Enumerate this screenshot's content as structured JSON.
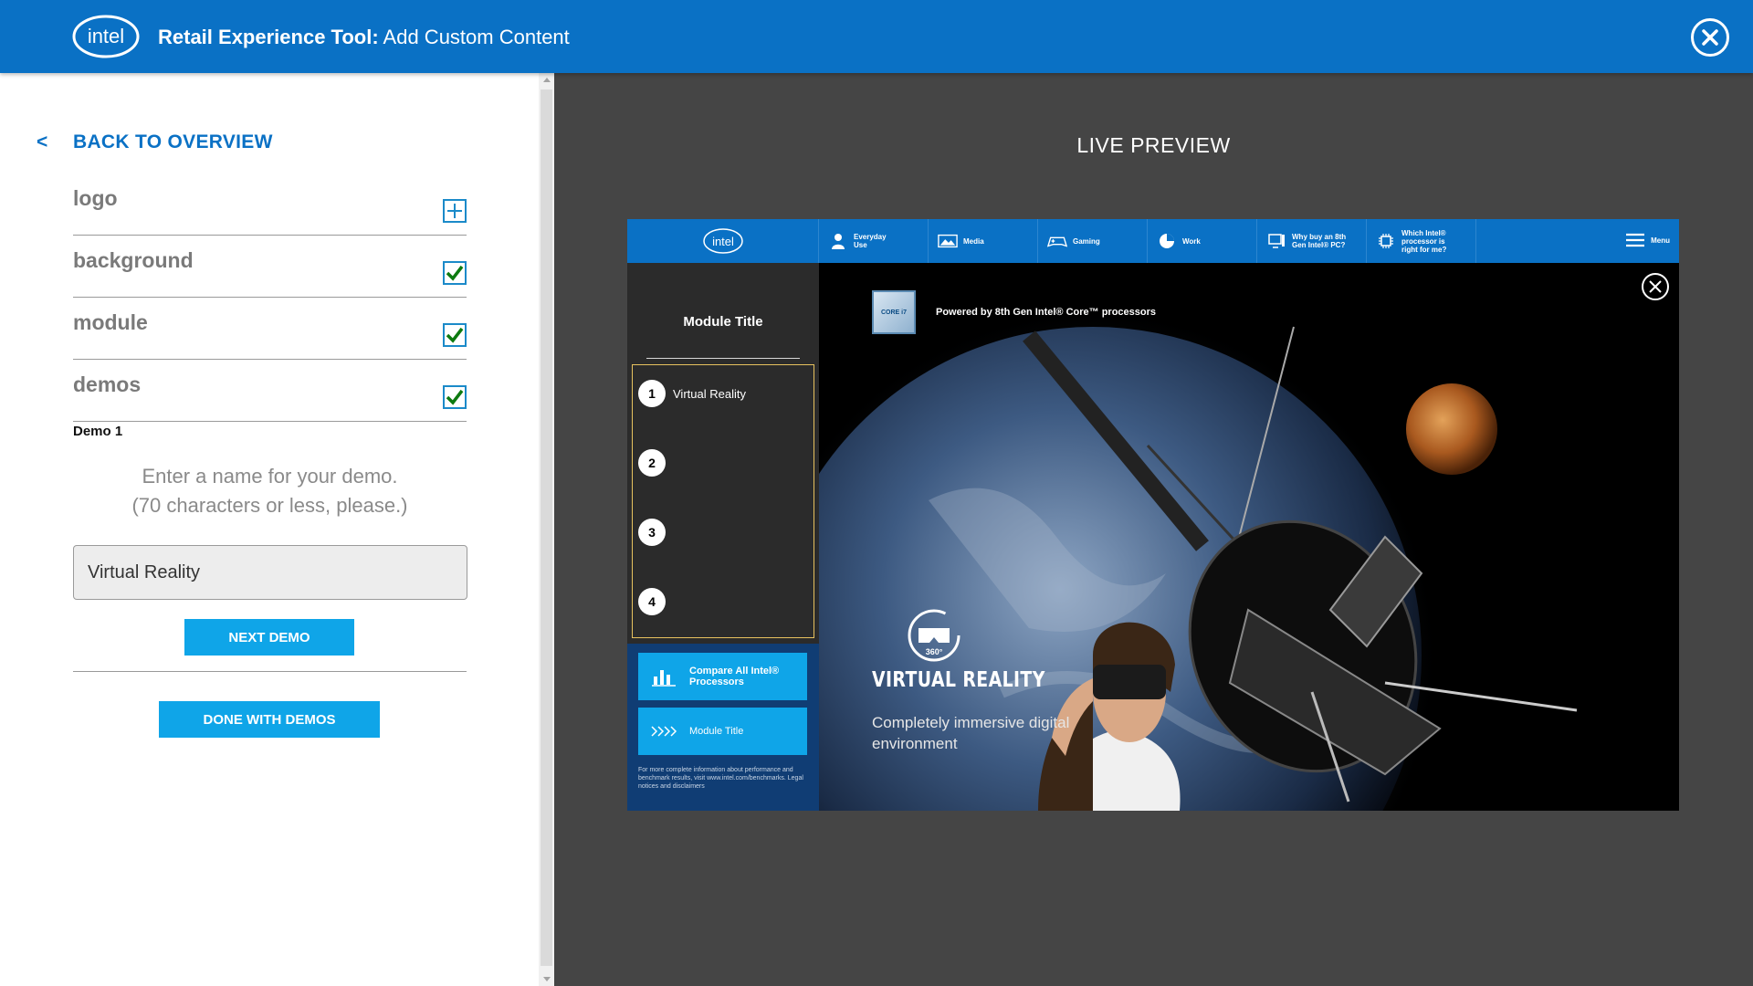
{
  "header": {
    "logo_text": "intel",
    "title_bold": "Retail Experience Tool:",
    "title_rest": " Add Custom Content"
  },
  "left": {
    "back_chevron": "<",
    "back_label": "BACK TO OVERVIEW",
    "sections": [
      {
        "label": "logo",
        "state": "add"
      },
      {
        "label": "background",
        "state": "checked"
      },
      {
        "label": "module",
        "state": "checked"
      },
      {
        "label": "demos",
        "state": "checked"
      }
    ],
    "demo_label": "Demo 1",
    "demo_hint_line1": "Enter a name for your demo.",
    "demo_hint_line2": "(70 characters or less, please.)",
    "demo_input_value": "Virtual Reality",
    "next_demo_label": "NEXT DEMO",
    "done_label": "DONE WITH DEMOS"
  },
  "preview": {
    "title": "LIVE PREVIEW",
    "nav": {
      "logo_text": "intel",
      "items": [
        {
          "label": "Everyday Use",
          "icon": "person-icon"
        },
        {
          "label": "Media",
          "icon": "image-icon"
        },
        {
          "label": "Gaming",
          "icon": "gamepad-icon"
        },
        {
          "label": "Work",
          "icon": "pie-chart-icon"
        },
        {
          "label": "Why buy an 8th Gen Intel® PC?",
          "icon": "desktop-icon"
        },
        {
          "label": "Which Intel® processor is right for me?",
          "icon": "chip-icon"
        }
      ],
      "menu_label": "Menu"
    },
    "side": {
      "module_title": "Module Title",
      "demos": [
        {
          "num": "1",
          "label": "Virtual Reality"
        },
        {
          "num": "2",
          "label": ""
        },
        {
          "num": "3",
          "label": ""
        },
        {
          "num": "4",
          "label": ""
        }
      ],
      "compare_label": "Compare All Intel® Processors",
      "module_button_label": "Module Title",
      "legal_text": "For more complete information about performance and benchmark results, visit www.intel.com/benchmarks. Legal notices and disclaimers"
    },
    "hero": {
      "chip_text": "CORE i7",
      "powered_by": "Powered by 8th Gen Intel® Core™ processors",
      "badge_360": "360°",
      "vr_title": "VIRTUAL REALITY",
      "vr_subtitle": "Completely immersive digital environment"
    }
  },
  "colors": {
    "intel_blue": "#0a71c5",
    "cyan_button": "#0fa5e8",
    "check_green": "#0d7a10",
    "dark_bg": "#454545"
  }
}
